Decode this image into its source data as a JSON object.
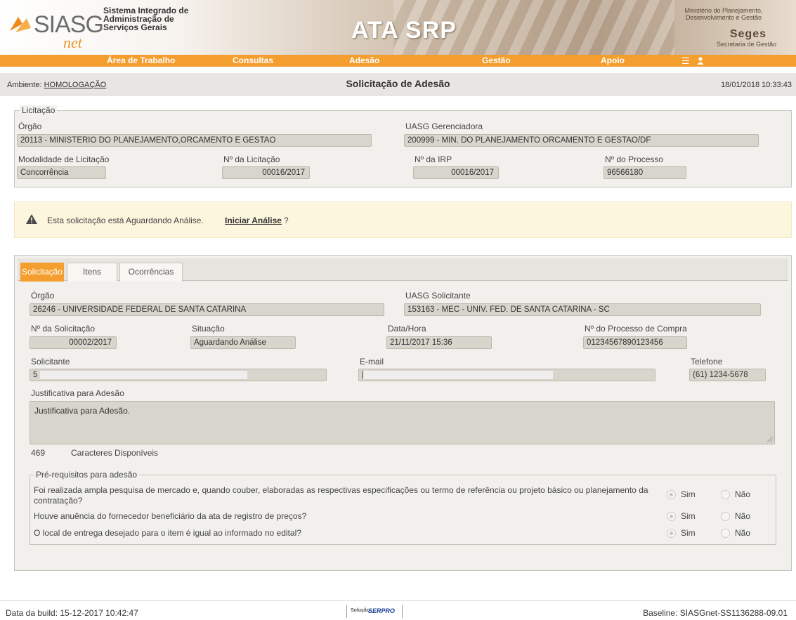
{
  "header": {
    "logo_main": "SIASG",
    "logo_sub": "net",
    "system_name_1": "Sistema Integrado de",
    "system_name_2": "Administração de",
    "system_name_3": "Serviços Gerais",
    "app_title": "ATA SRP",
    "ministry_1": "Ministério do Planejamento,",
    "ministry_2": "Desenvolvimento e Gestão",
    "seges": "Seges",
    "seges_sub": "Secretaria de Gestão"
  },
  "nav": {
    "items": [
      {
        "label": "Área de Trabalho"
      },
      {
        "label": "Consultas"
      },
      {
        "label": "Adesão"
      },
      {
        "label": "Gestão"
      },
      {
        "label": "Apoio"
      }
    ],
    "menu_icon": "hamburger-icon",
    "user_icon": "user-icon"
  },
  "ambient": {
    "label": "Ambiente:",
    "value": "HOMOLOGAÇÃO",
    "page_title": "Solicitação de Adesão",
    "datetime": "18/01/2018 10:33:43"
  },
  "licitacao": {
    "legend": "Licitação",
    "orgao_label": "Órgão",
    "orgao_value": "20113 - MINISTERIO DO PLANEJAMENTO,ORCAMENTO E GESTAO",
    "uasg_label": "UASG Gerenciadora",
    "uasg_value": "200999 - MIN. DO PLANEJAMENTO ORCAMENTO E GESTAO/DF",
    "modalidade_label": "Modalidade de Licitação",
    "modalidade_value": "Concorrência",
    "num_licitacao_label": "Nº da Licitação",
    "num_licitacao_value": "00016/2017",
    "num_irp_label": "Nº da IRP",
    "num_irp_value": "00016/2017",
    "num_processo_label": "Nº do Processo",
    "num_processo_value": "96566180"
  },
  "alert": {
    "icon": "warning-icon",
    "message": "Esta solicitação está Aguardando Análise.",
    "link": "Iniciar Análise",
    "suffix": "?"
  },
  "tabs": [
    {
      "label": "Solicitação"
    },
    {
      "label": "Itens"
    },
    {
      "label": "Ocorrências"
    }
  ],
  "solicitacao": {
    "orgao_label": "Órgão",
    "orgao_value": "26246 - UNIVERSIDADE FEDERAL DE SANTA CATARINA",
    "uasg_label": "UASG Solicitante",
    "uasg_value": "153163 - MEC - UNIV. FED. DE SANTA CATARINA - SC",
    "num_solic_label": "Nº da Solicitação",
    "num_solic_value": "00002/2017",
    "situacao_label": "Situação",
    "situacao_value": "Aguardando Análise",
    "datahora_label": "Data/Hora",
    "datahora_value": "21/11/2017 15:36",
    "proc_compra_label": "Nº do Processo de Compra",
    "proc_compra_value": "01234567890123456",
    "solicitante_label": "Solicitante",
    "solicitante_value": "5",
    "email_label": "E-mail",
    "email_value": "|",
    "telefone_label": "Telefone",
    "telefone_value": "(61) 1234-5678",
    "justificativa_label": "Justificativa para Adesão",
    "justificativa_value": "Justificativa para Adesão.",
    "chars_count": "469",
    "chars_label": "Caracteres Disponíveis"
  },
  "prerequisitos": {
    "legend": "Pré-requisitos para adesão",
    "questions": [
      {
        "text": "Foi realizada ampla pesquisa de mercado e, quando couber, elaboradas as respectivas especificações ou termo de referência ou projeto básico ou planejamento da",
        "text2": "contratação?",
        "yes": "Sim",
        "no": "Não"
      },
      {
        "text": "Houve anuência do fornecedor beneficiário da ata de registro de preços?",
        "yes": "Sim",
        "no": "Não"
      },
      {
        "text": "O local de entrega desejado para o item é igual ao informado no edital?",
        "yes": "Sim",
        "no": "Não"
      }
    ]
  },
  "footer": {
    "build": "Data da build: 15-12-2017 10:42:47",
    "serpro_1": "Solução",
    "serpro_2": "SERPRO",
    "baseline": "Baseline: SIASGnet-SS1136288-09.01"
  }
}
